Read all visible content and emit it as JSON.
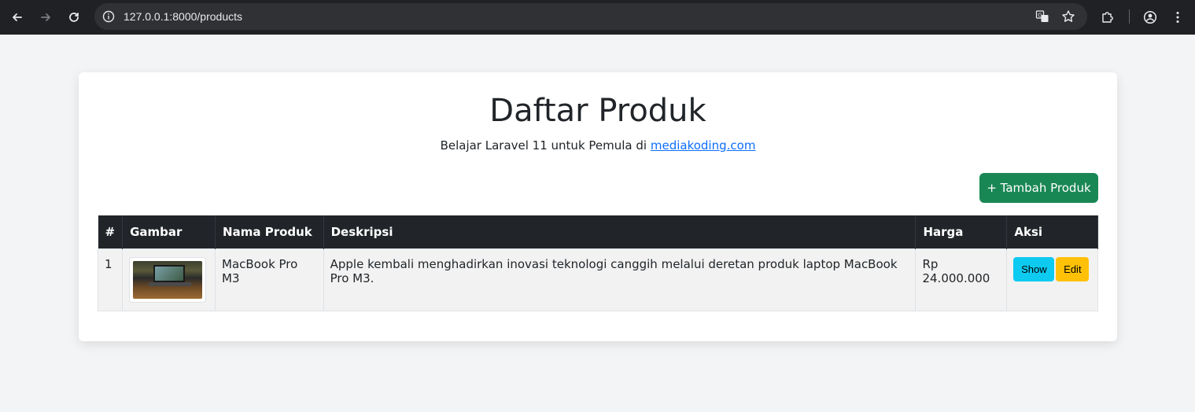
{
  "browser": {
    "url": "127.0.0.1:8000/products",
    "icons": {
      "back": "arrow-left-icon",
      "forward": "arrow-right-icon",
      "reload": "reload-icon",
      "site_info": "info-icon",
      "translate": "translate-icon",
      "bookmark": "star-icon",
      "extensions": "puzzle-icon",
      "profile": "profile-icon",
      "menu": "kebab-menu-icon"
    }
  },
  "page": {
    "title": "Daftar Produk",
    "subtitle_prefix": "Belajar Laravel 11 untuk Pemula di",
    "subtitle_link": "mediakoding.com",
    "add_button": "+ Tambah Produk"
  },
  "table": {
    "headers": [
      "#",
      "Gambar",
      "Nama Produk",
      "Deskripsi",
      "Harga",
      "Aksi"
    ],
    "rows": [
      {
        "no": "1",
        "name": "MacBook Pro M3",
        "description": "Apple kembali menghadirkan inovasi teknologi canggih melalui deretan produk laptop MacBook Pro M3.",
        "price": "Rp 24.000.000",
        "show_label": "Show",
        "edit_label": "Edit"
      }
    ]
  },
  "colors": {
    "success": "#198754",
    "info": "#0dcaf0",
    "warning": "#ffc107",
    "header_dark": "#212529",
    "link": "#0d6efd"
  }
}
